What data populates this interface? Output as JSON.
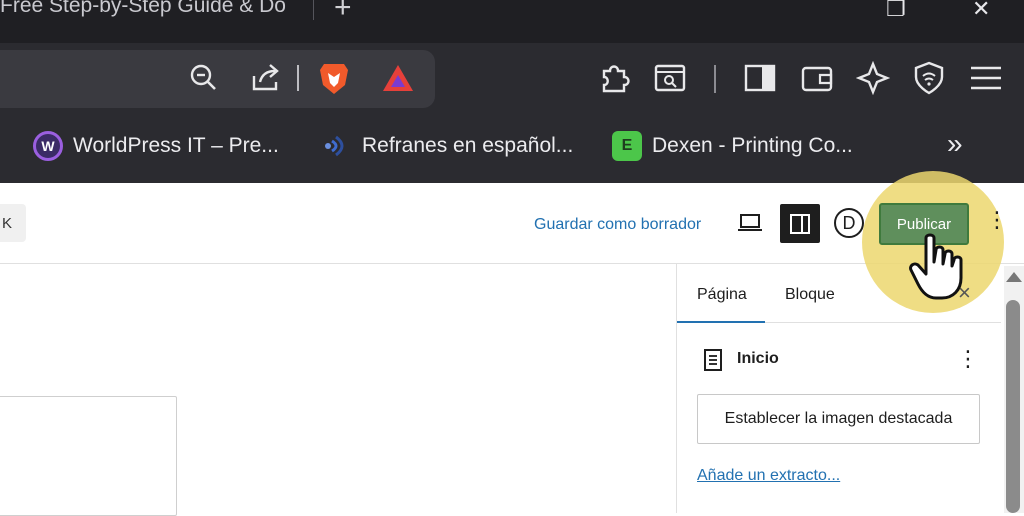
{
  "browser": {
    "tab_title": "Free Step-by-Step Guide & Do",
    "new_tab_symbol": "+",
    "window_controls": {
      "minimize": "—",
      "maximize": "❐",
      "close": "✕"
    },
    "toolbar_icons": [
      "zoom-out-icon",
      "share-icon",
      "brave-shields-lion-icon",
      "brave-rewards-triangle-icon",
      "extensions-puzzle-icon",
      "reader-mode-icon",
      "sidebar-toggle-icon",
      "wallet-icon",
      "leo-ai-icon",
      "vpn-shield-icon",
      "hamburger-menu-icon"
    ],
    "bookmarks": [
      {
        "label": "WorldPress IT – Pre...",
        "icon": "W",
        "color": "#6b3fa0"
      },
      {
        "label": "Refranes en español...",
        "icon": "sound-icon",
        "color": "#2d4f9e"
      },
      {
        "label": "Dexen - Printing Co...",
        "icon": "E",
        "color": "#4cc64a"
      }
    ],
    "bookmarks_overflow": "»"
  },
  "editor": {
    "left_button_text": "K",
    "save_draft_label": "Guardar como borrador",
    "publish_label": "Publicar",
    "settings_icon_letter": "D",
    "more_icon": "⋮",
    "accent_color": "#2271b1",
    "publish_color": "#5f8f5c"
  },
  "sidebar": {
    "tabs": [
      {
        "label": "Página",
        "active": true
      },
      {
        "label": "Bloque",
        "active": false
      }
    ],
    "close_symbol": "×",
    "page_title": "Inicio",
    "featured_image_label": "Establecer la imagen destacada",
    "excerpt_link": "Añade un extracto..."
  }
}
